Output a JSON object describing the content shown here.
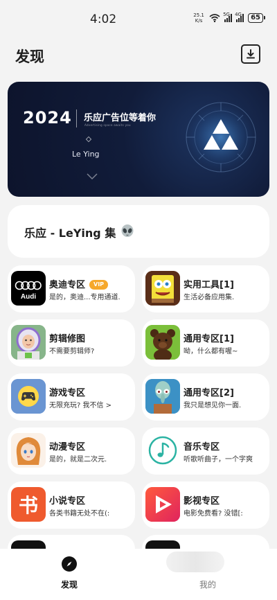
{
  "status_bar": {
    "time": "4:02",
    "net_speed_value": "25.1",
    "net_speed_unit": "K/s",
    "sim1": "5G",
    "sim2": "4G",
    "battery": "65"
  },
  "header": {
    "title": "发现",
    "download_icon": "download-box-icon"
  },
  "banner": {
    "year": "2024",
    "headline": "乐应广告位等着你",
    "subtitle": "Advertising space awaits you",
    "brand": "Le Ying",
    "colors": {
      "bg_dark": "#0d142c",
      "glow": "#5fb4ff"
    }
  },
  "collection": {
    "title": "乐应 - LeYing 集",
    "icon": "alien-emoji-icon"
  },
  "categories": [
    {
      "title": "奥迪专区",
      "badge": "VIP",
      "desc": "是的，奥迪...专用通道.",
      "icon": "audi-logo-icon"
    },
    {
      "title": "实用工具[1]",
      "desc": "生活必备应用集.",
      "icon": "spongebob-avatar-icon"
    },
    {
      "title": "剪辑修图",
      "desc": "不需要剪辑师?",
      "icon": "buzz-lightyear-avatar-icon"
    },
    {
      "title": "通用专区[1]",
      "desc": "呦，什么都有喔~",
      "icon": "bear-avatar-icon"
    },
    {
      "title": "游戏专区",
      "desc": "无限充玩? 我不信 >",
      "icon": "gamepad-icon"
    },
    {
      "title": "通用专区[2]",
      "desc": "我只是想见你一面.",
      "icon": "squidward-avatar-icon"
    },
    {
      "title": "动漫专区",
      "desc": "是的，就是二次元.",
      "icon": "anime-girl-avatar-icon"
    },
    {
      "title": "音乐专区",
      "desc": "听歌听曲子，一个字爽",
      "icon": "music-note-icon"
    },
    {
      "title": "小说专区",
      "desc": "各类书籍无处不在(:",
      "icon": "book-char-icon",
      "icon_text": "书"
    },
    {
      "title": "影视专区",
      "desc": "电影免费看? 没错[:",
      "icon": "play-triangle-icon"
    }
  ],
  "tabs": [
    {
      "label": "发现",
      "icon": "compass-icon",
      "active": true
    },
    {
      "label": "我的",
      "icon": "profile-icon",
      "active": false
    }
  ],
  "colors": {
    "page_bg": "#f3f3f3",
    "card_bg": "#ffffff",
    "vip_badge": "#f6a82b"
  }
}
